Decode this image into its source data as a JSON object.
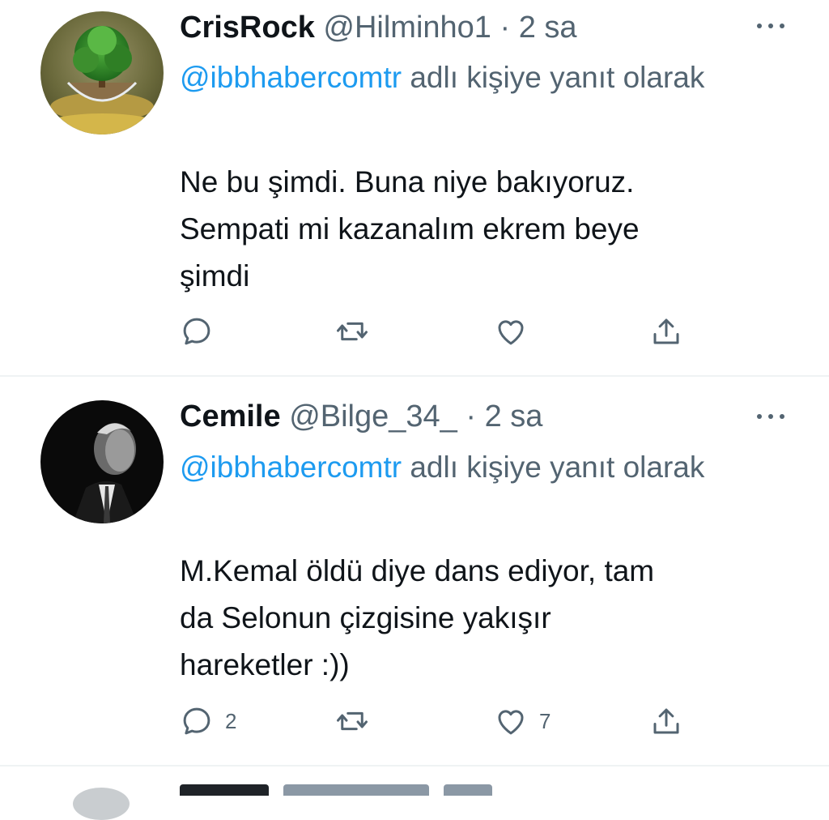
{
  "tweets": [
    {
      "name": "CrisRock",
      "handle": "@Hilminho1",
      "dot": "·",
      "time": "2 sa",
      "reply_mention": "@ibbhabercomtr",
      "reply_suffix": " adlı kişiye yanıt olarak",
      "text_lines": [
        "Ne bu şimdi. Buna niye bakıyoruz.",
        "Sempati mi kazanalım ekrem beye",
        "şimdi"
      ],
      "reply_count": "",
      "like_count": ""
    },
    {
      "name": "Cemile",
      "handle": "@Bilge_34_",
      "dot": "·",
      "time": "2 sa",
      "reply_mention": "@ibbhabercomtr",
      "reply_suffix": " adlı kişiye yanıt olarak",
      "text_lines": [
        "M.Kemal öldü diye dans ediyor, tam",
        "da Selonun çizgisine yakışır",
        "hareketler :))"
      ],
      "reply_count": "2",
      "like_count": "7"
    }
  ],
  "colors": {
    "accent": "#1d9bf0",
    "secondary_text": "#536471",
    "primary_text": "#0f1419",
    "divider": "#eff3f4"
  },
  "icons": [
    "reply-icon",
    "retweet-icon",
    "like-icon",
    "share-icon",
    "more-icon"
  ]
}
